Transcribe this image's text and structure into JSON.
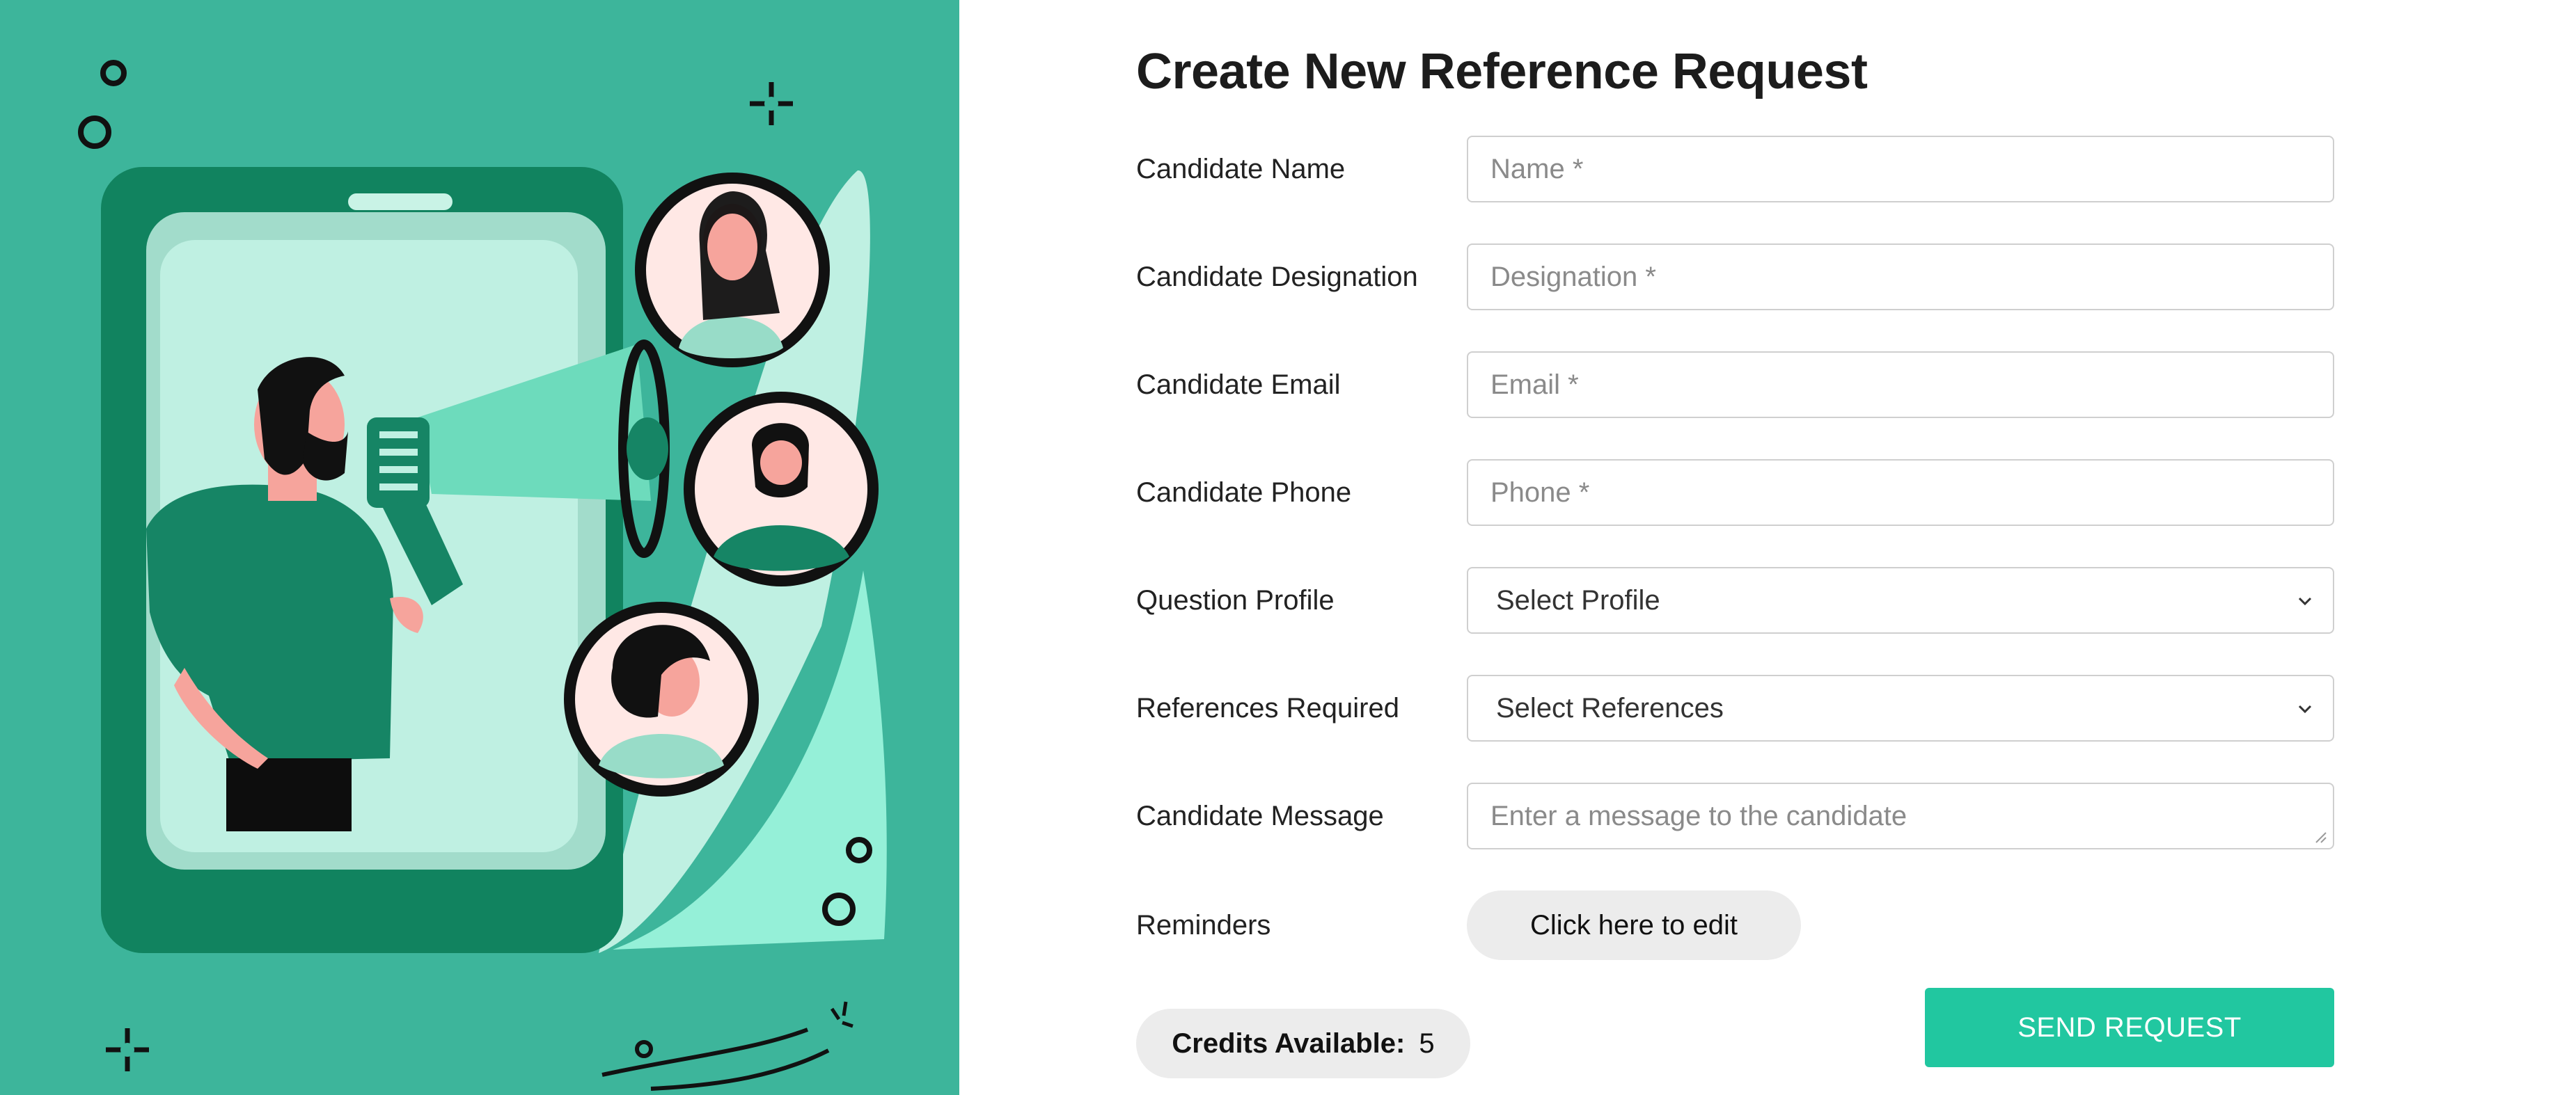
{
  "form": {
    "title": "Create New Reference Request",
    "fields": [
      {
        "label": "Candidate Name",
        "placeholder": "Name *"
      },
      {
        "label": "Candidate Designation",
        "placeholder": "Designation *"
      },
      {
        "label": "Candidate Email",
        "placeholder": "Email *"
      },
      {
        "label": "Candidate Phone",
        "placeholder": "Phone *"
      },
      {
        "label": "Question Profile",
        "selected": "Select Profile"
      },
      {
        "label": "References Required",
        "selected": "Select References"
      },
      {
        "label": "Candidate Message",
        "placeholder": "Enter a message to the candidate"
      },
      {
        "label": "Reminders",
        "button_label": "Click here to edit"
      }
    ],
    "credits": {
      "label": "Credits Available:",
      "value": "5"
    },
    "send_label": "SEND REQUEST"
  },
  "colors": {
    "illustration_bg": "#3db59b",
    "accent_button": "#21c7a0",
    "pill_bg": "#ececec",
    "border": "#cfcfcf"
  },
  "icons": {
    "select_arrow": "chevron-down-icon",
    "textarea_resize": "resize-grip-icon"
  }
}
